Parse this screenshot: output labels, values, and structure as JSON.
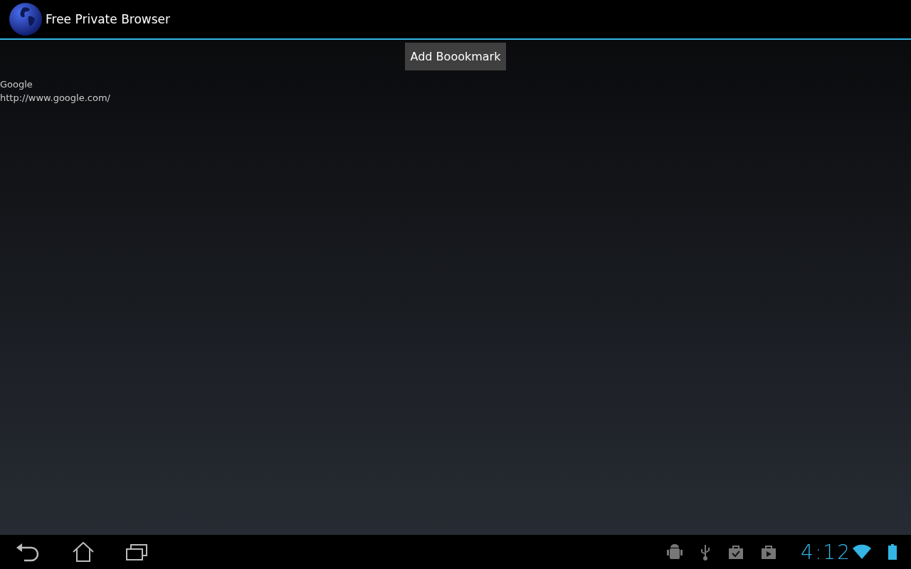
{
  "app_bar": {
    "title": "Free Private Browser"
  },
  "add_button": {
    "label": "Add Boookmark"
  },
  "bookmarks": [
    {
      "title": "Google",
      "url": "http://www.google.com/"
    }
  ],
  "status_bar": {
    "time": "4:12"
  }
}
